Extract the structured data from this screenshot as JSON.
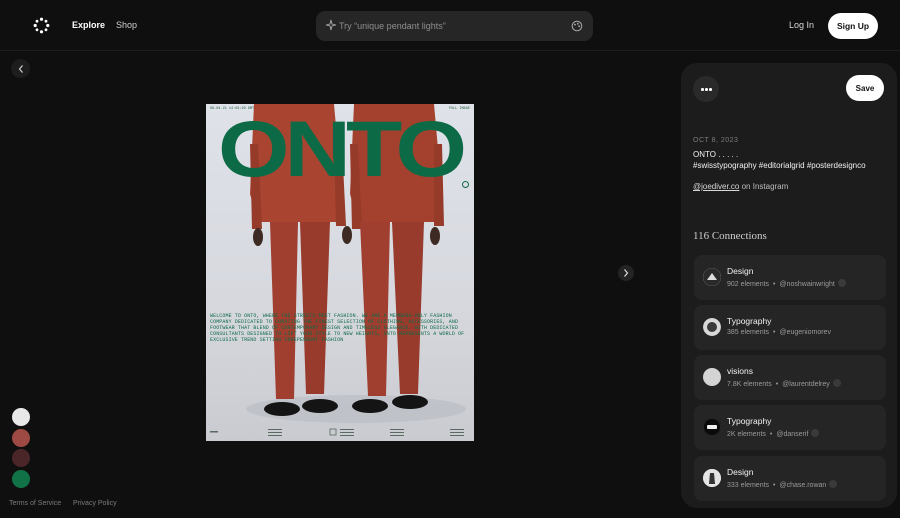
{
  "header": {
    "nav": {
      "explore": "Explore",
      "shop": "Shop"
    },
    "search": {
      "placeholder": "Try “unique pendant lights”"
    },
    "login": "Log In",
    "signup": "Sign Up"
  },
  "poster": {
    "title": "ONTO",
    "top_left": "09.04.21 14:03:20 GMT",
    "top_right": "FULL IMAGE",
    "body_text": "WELCOME TO ONTO, WHERE THE STREETS MEET FASHION. WE ARE A MEMBERS-ONLY FASHION COMPANY DEDICATED TO CURATING THE FINEST SELECTION OF CLOTHING, ACCESSORIES, AND FOOTWEAR THAT BLEND OF CONTEMPORARY DESIGN AND TIMELESS ELEGANCE. WITH DEDICATED CONSULTANTS DESIGNED TO LIFT YOUR STYLE TO NEW HEIGHTS, ONTO REPRESENTS A WORLD OF EXCLUSIVE TREND SETTING INDEPENDENT FASHION"
  },
  "swatches": [
    "#e8e8e8",
    "#9c4a43",
    "#4b2629",
    "#127247"
  ],
  "footer": {
    "terms": "Terms of Service",
    "privacy": "Privacy Policy"
  },
  "panel": {
    "save": "Save",
    "date": "OCT 8, 2023",
    "description_line1": "ONTO . . . . .",
    "description_line2": "#swisstypography #editorialgrid #posterdesignco",
    "credit_handle": "@joediver.co",
    "credit_suffix": " on Instagram",
    "connections_count": "116 Connections",
    "connections": [
      {
        "title": "Design",
        "elements": "902 elements",
        "user": "@noshwainwright"
      },
      {
        "title": "Typography",
        "elements": "385 elements",
        "user": "@eugeniomorev"
      },
      {
        "title": "visions",
        "elements": "7.8K elements",
        "user": "@laurentdelrey"
      },
      {
        "title": "Typography",
        "elements": "2K elements",
        "user": "@danserif"
      },
      {
        "title": "Design",
        "elements": "333 elements",
        "user": "@chase.rowan"
      }
    ]
  },
  "colors": {
    "accent_green": "#0d6a46",
    "suit_red": "#a94431",
    "panel_bg": "#1c1c1c"
  },
  "icons": {
    "logo": "dot-ring-logo",
    "search": "sparkle-icon",
    "palette": "palette-icon",
    "back": "chevron-left-icon",
    "next": "chevron-right-icon",
    "more": "more-dots-icon",
    "verified": "check-badge-icon"
  }
}
